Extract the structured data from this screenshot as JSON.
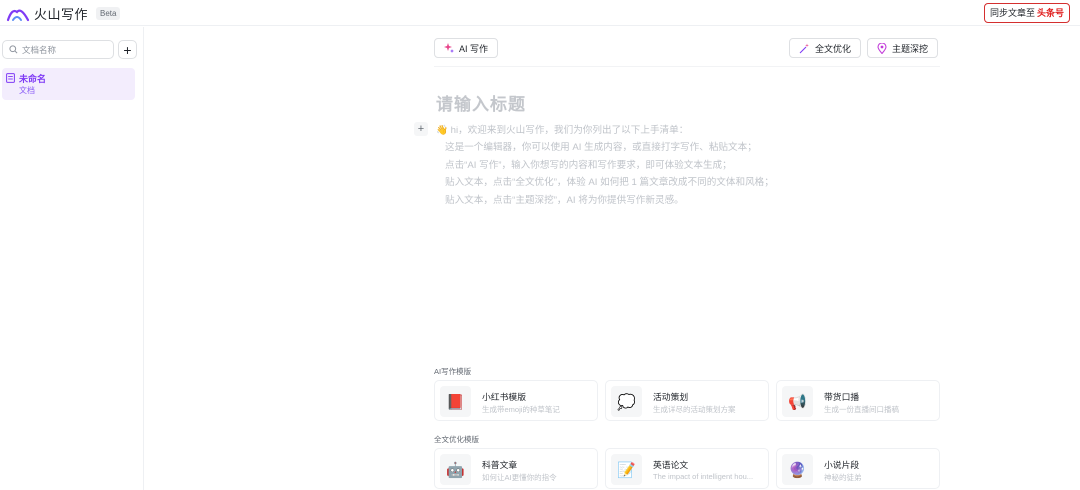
{
  "header": {
    "app_name": "火山写作",
    "beta_badge": "Beta",
    "sync_prefix": "同步文章至",
    "sync_target": "头条号",
    "brand_color": "#e02020",
    "logo_icon": "volcano-logo-icon"
  },
  "sidebar": {
    "search_placeholder": "文档名称",
    "add_icon": "plus-icon",
    "documents": [
      {
        "title": "未命名",
        "type": "文档",
        "icon": "document-icon",
        "active": true
      }
    ],
    "active_color": "#7f3bf5"
  },
  "toolbar": {
    "ai_write_label": "AI 写作",
    "optimize_label": "全文优化",
    "topic_label": "主题深挖"
  },
  "editor": {
    "title_placeholder": "请输入标题",
    "intro_lines": [
      "👋 hi，欢迎来到火山写作，我们为你列出了以下上手清单：",
      "这是一个编辑器，你可以使用 AI 生成内容，或直接打字写作、粘贴文本；",
      "点击“AI 写作”，输入你想写的内容和写作要求，即可体验文本生成；",
      "贴入文本，点击“全文优化”，体验 AI 如何把 1 篇文章改成不同的文体和风格；",
      "贴入文本，点击“主题深挖”，AI 将为你提供写作新灵感。"
    ]
  },
  "templates": {
    "ai_section_label": "AI写作模版",
    "ai_cards": [
      {
        "icon": "📕",
        "title": "小红书模版",
        "desc": "生成带emoji的种草笔记"
      },
      {
        "icon": "💭",
        "title": "活动策划",
        "desc": "生成详尽的活动策划方案"
      },
      {
        "icon": "📢",
        "title": "带货口播",
        "desc": "生成一份直播间口播稿"
      }
    ],
    "optimize_section_label": "全文优化模版",
    "optimize_cards": [
      {
        "icon": "🤖",
        "title": "科普文章",
        "desc": "如何让AI更懂你的指令"
      },
      {
        "icon": "📝",
        "title": "英语论文",
        "desc": "The impact of intelligent hou..."
      },
      {
        "icon": "🔮",
        "title": "小说片段",
        "desc": "神秘的徒弟"
      }
    ]
  }
}
